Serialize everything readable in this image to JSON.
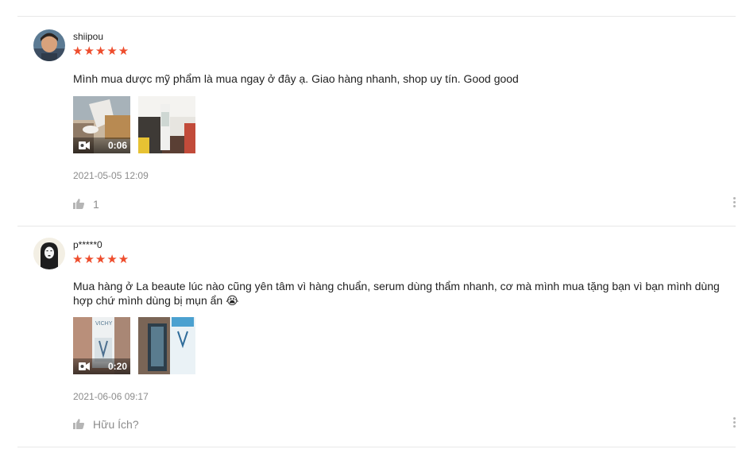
{
  "reviews": [
    {
      "username": "shiipou",
      "stars": "★★★★★",
      "content": "Mình mua dược mỹ phẩm là mua ngay ở đây ạ. Giao hàng nhanh, shop uy tín. Good good",
      "video_duration": "0:06",
      "timestamp": "2021-05-05 12:09",
      "like_text": "1"
    },
    {
      "username": "p*****0",
      "stars": "★★★★★",
      "content_line1": "Mua hàng ở La beaute lúc nào cũng yên tâm vì hàng chuẩn, serum dùng thẩm nhanh, cơ mà mình mua tặng bạn vì bạn mình dùng",
      "content_line2": "hợp chứ mình dùng bị mụn ẩn",
      "emoji": "😭",
      "video_duration": "0:20",
      "timestamp": "2021-06-06 09:17",
      "like_text": "Hữu Ích?"
    }
  ],
  "colors": {
    "star": "#ee4d2d",
    "muted": "#8c8c8c",
    "divider": "#e8e8e8"
  }
}
